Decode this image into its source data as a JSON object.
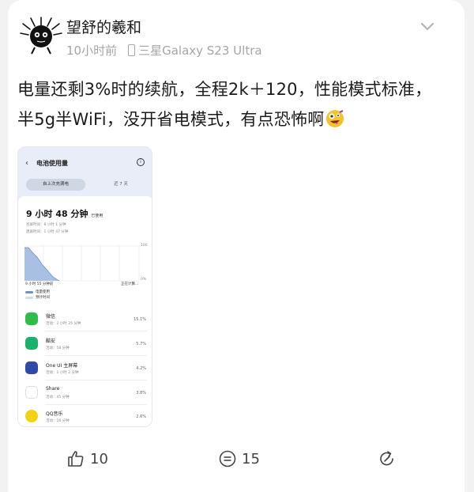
{
  "post": {
    "username": "望舒的羲和",
    "time": "10小时前",
    "device": "三星Galaxy S23 Ultra",
    "text": "电量还剩3%时的续航，全程2k＋120，性能模式标准，半5g半WiFi，没开省电模式，有点恐怖啊",
    "emoji": "zany-face-emoji"
  },
  "screenshot": {
    "title": "电池使用量",
    "tab_active": "自上次充满电",
    "tab_other": "近 7 天",
    "usage_time": "9 小时 48 分钟",
    "usage_suffix": "已使用",
    "screen_time": "亮屏时间：8 小时 1 分钟",
    "standby_time": "熄屏时间：1 小时 47 分钟",
    "axis_max": "100",
    "axis_min": "0%",
    "chart_start": "9 小时 55 分钟前",
    "chart_end": "正在计算...",
    "legend_1": "电量使用",
    "legend_2": "预计时间",
    "apps": [
      {
        "name": "微信",
        "sub": "活动：2 小时 25 分钟",
        "pct": "15.1%",
        "color": "#2dbe4a"
      },
      {
        "name": "酷安",
        "sub": "活动：58 分钟",
        "pct": "5.7%",
        "color": "#19b26b"
      },
      {
        "name": "One UI 主屏幕",
        "sub": "活动：1 小时 2 分钟",
        "pct": "4.2%",
        "color": "#2f4aa8"
      },
      {
        "name": "Share",
        "sub": "活动：45 分钟",
        "pct": "3.8%",
        "color": "#ffffff"
      },
      {
        "name": "QQ音乐",
        "sub": "活动：16 分钟",
        "pct": "2.6%",
        "color": "#f5d20f"
      }
    ]
  },
  "footer": {
    "likes": "10",
    "comments": "15"
  }
}
